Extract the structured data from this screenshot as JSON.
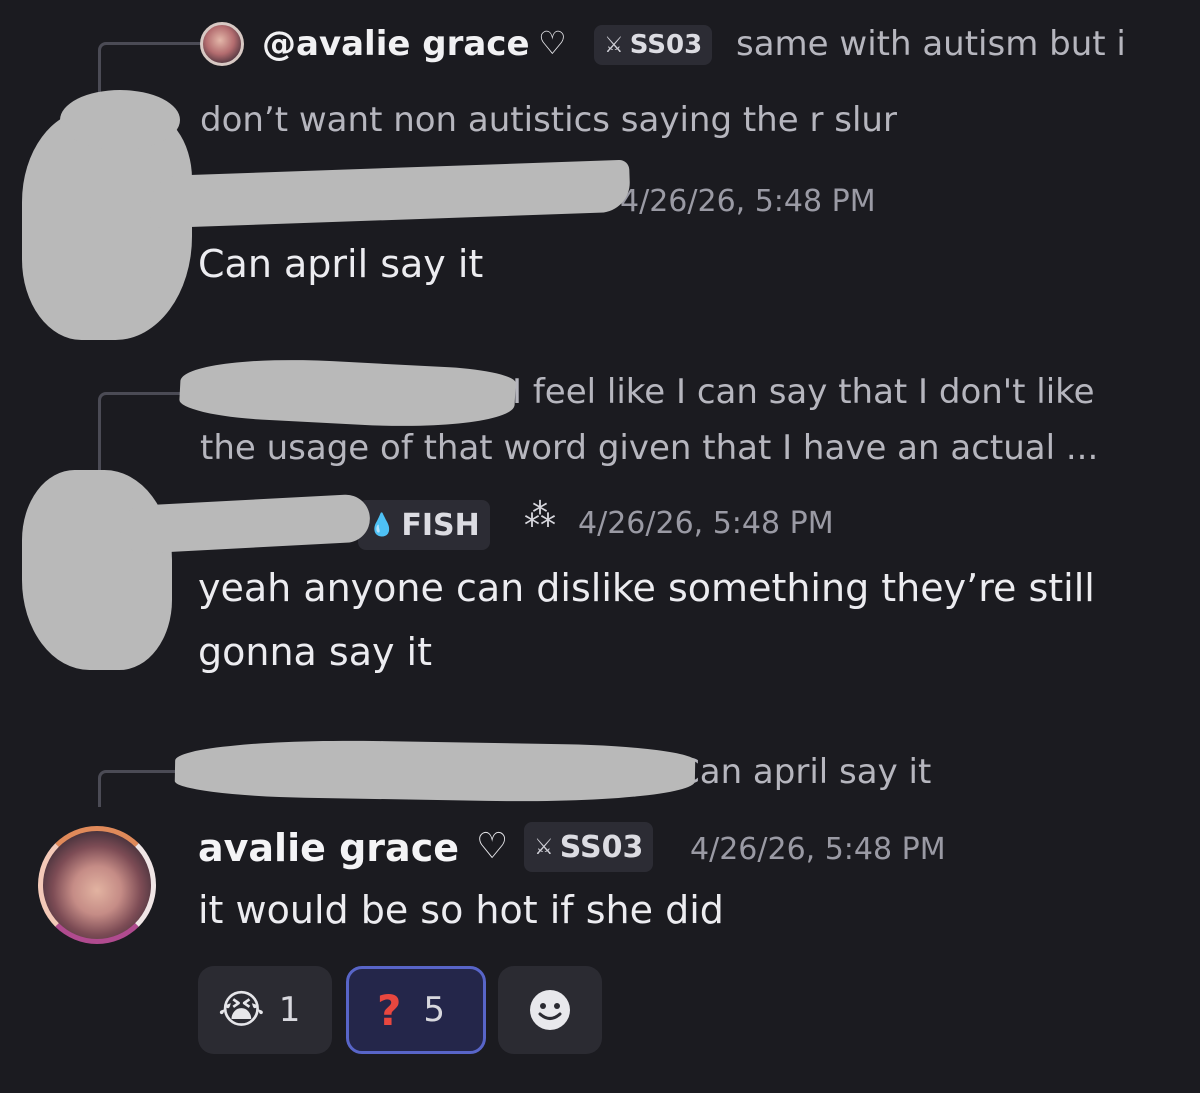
{
  "reply1": {
    "username": "@avalie grace",
    "heart": "♡",
    "tag_icon": "sword-icon",
    "tag": "SS03",
    "preview_line1": "same with autism but i",
    "preview_line2": "don’t want non autistics saying the r slur"
  },
  "message1": {
    "timestamp": "4/26/26, 5:48 PM",
    "text": "Can april say it"
  },
  "reply2": {
    "preview_line1": "I feel like I can say that I don't like",
    "preview_line2": "the usage of that word given that I have an actual ..."
  },
  "message2": {
    "tag_icon": "droplet-icon",
    "tag": "FISH",
    "status_icon": "exclamation-sparkle-icon",
    "timestamp": "4/26/26, 5:48 PM",
    "text_line1": "yeah anyone can dislike something they’re still",
    "text_line2": "gonna say it"
  },
  "reply3": {
    "preview": "Can april say it"
  },
  "message3": {
    "author": "avalie grace",
    "heart": "♡",
    "tag_icon": "sword-icon",
    "tag": "SS03",
    "timestamp": "4/26/26, 5:48 PM",
    "text": "it would be so hot if she did"
  },
  "reactions": [
    {
      "emoji": "😭",
      "count": "1",
      "active": false
    },
    {
      "emoji": "?",
      "count": "5",
      "active": true
    }
  ],
  "add_reaction_icon": "smiley-add-icon",
  "colors": {
    "background": "#1b1b20",
    "active_reaction_border": "#5865c8",
    "question_red": "#e8473f"
  }
}
